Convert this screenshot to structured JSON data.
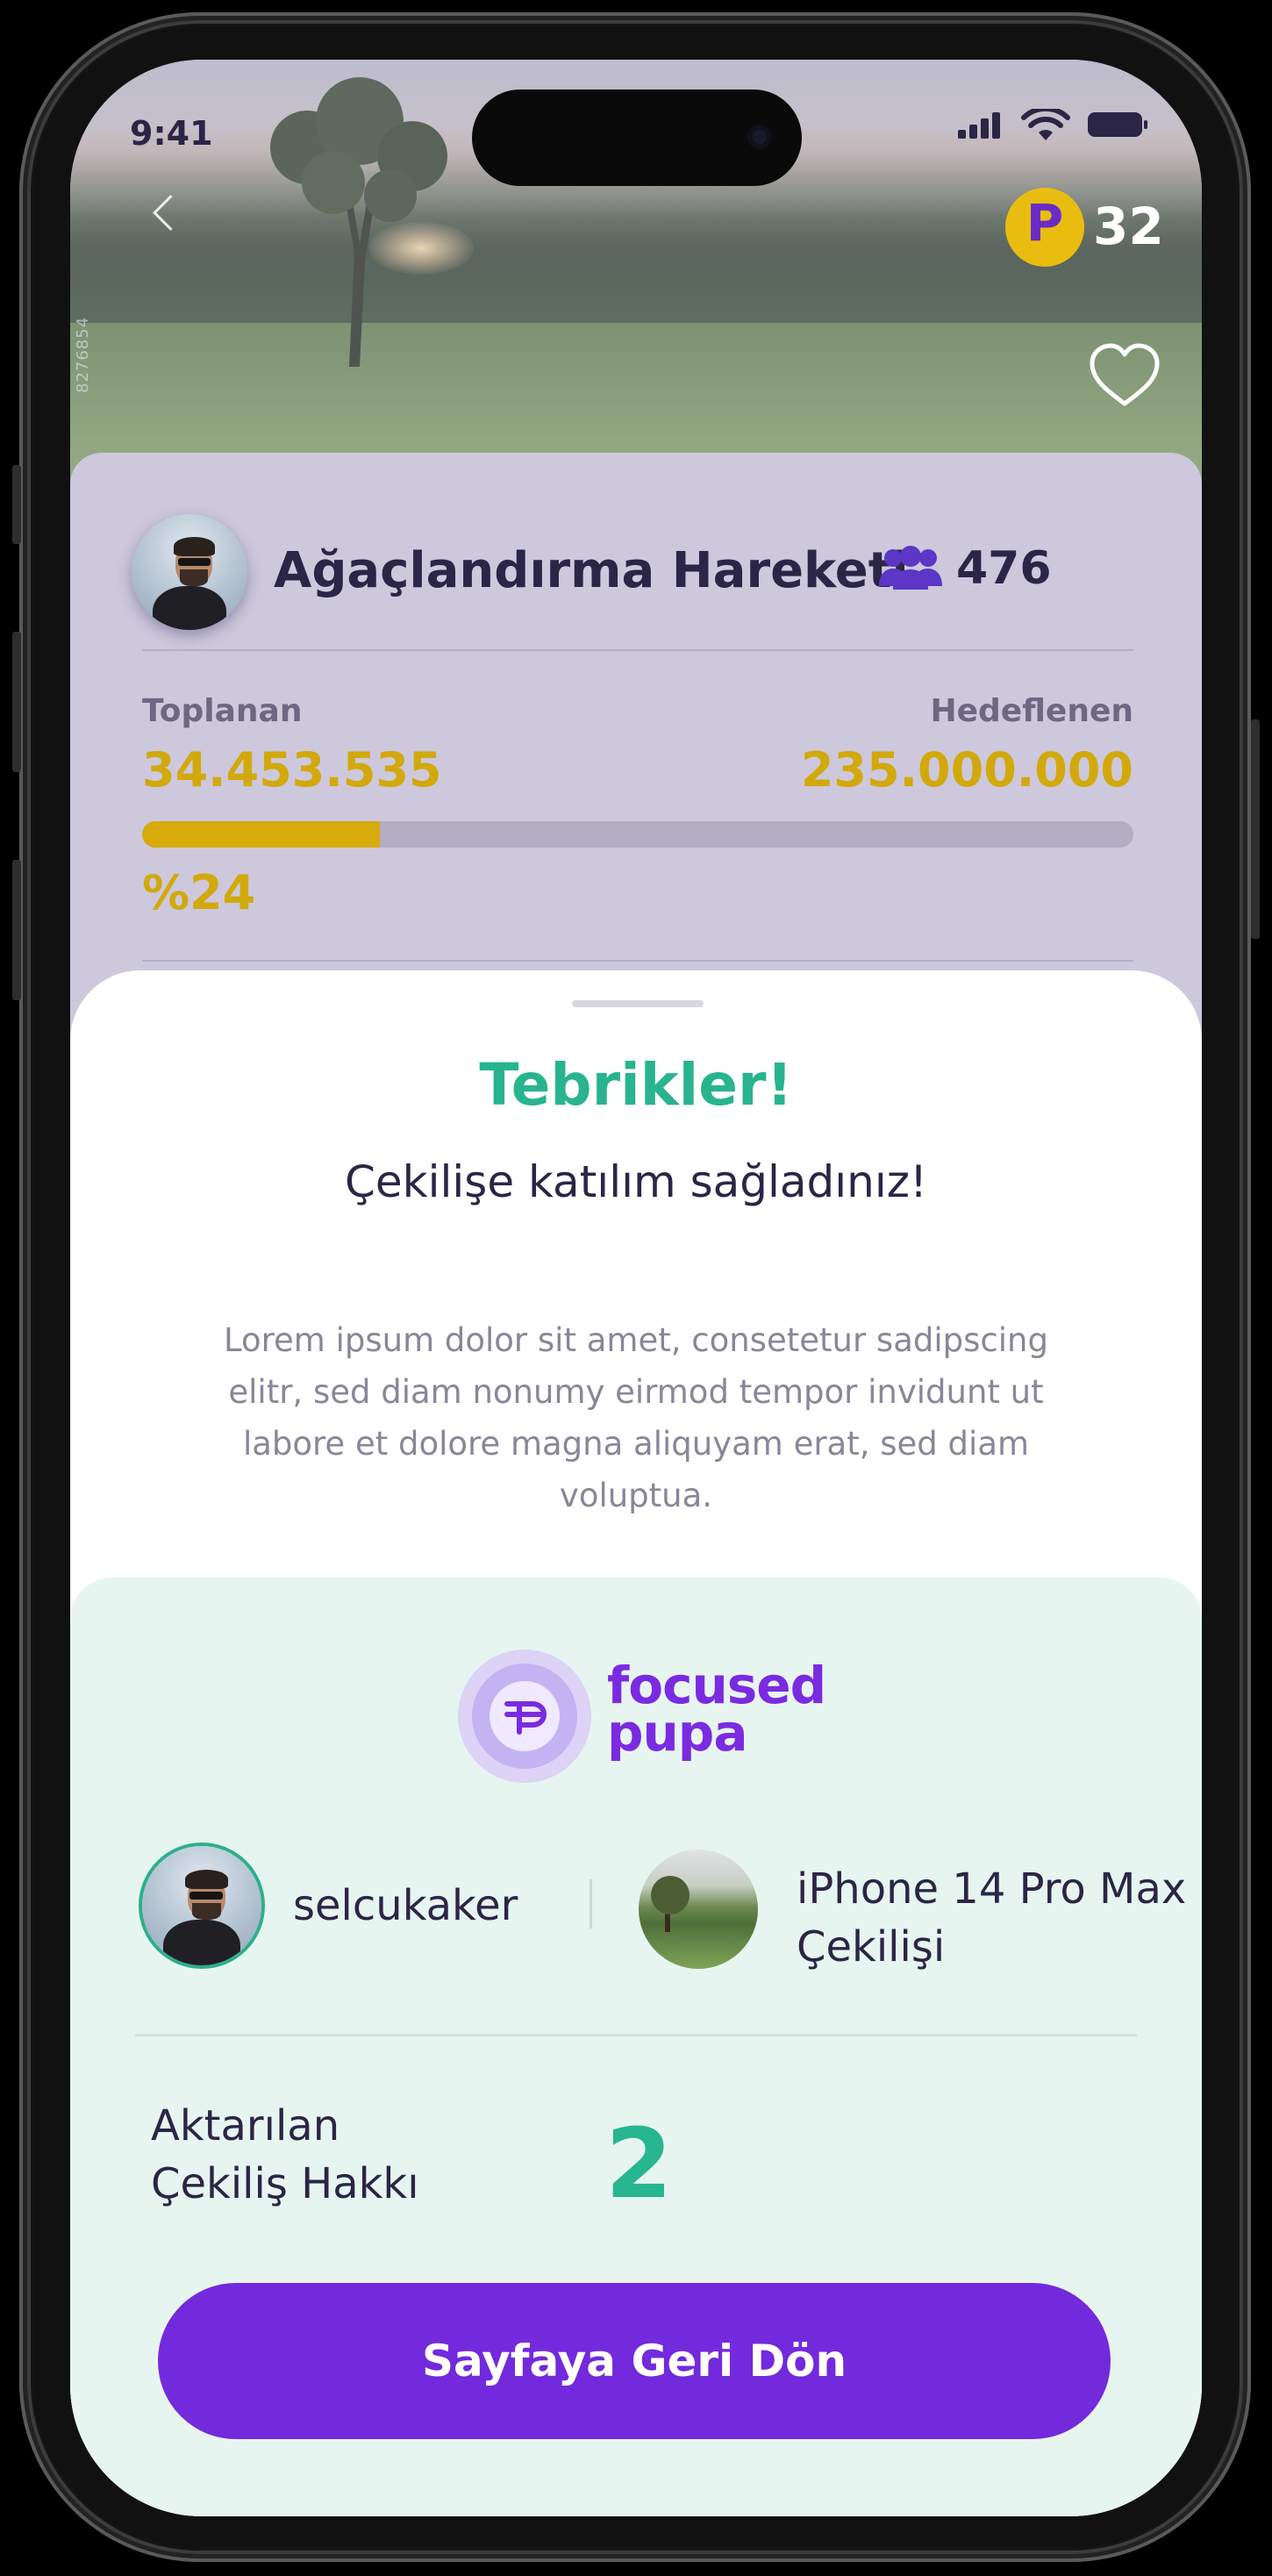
{
  "status_bar": {
    "time": "9:41"
  },
  "hero": {
    "watermark": "8276854",
    "coin_letter": "P",
    "coin_count": "32"
  },
  "campaign": {
    "title": "Ağaçlandırma Hareketi",
    "participants": "476",
    "collected_label": "Toplanan",
    "collected_value": "34.453.535",
    "target_label": "Hedeflenen",
    "target_value": "235.000.000",
    "progress_percent_text": "%24",
    "progress_fraction": 0.24
  },
  "sheet": {
    "title": "Tebrikler!",
    "subtitle": "Çekilişe katılım sağladınız!",
    "body": "Lorem ipsum dolor sit amet, consetetur sadipscing elitr, sed diam nonumy eirmod tempor invidunt ut labore et dolore magna aliquyam erat, sed diam voluptua."
  },
  "summary": {
    "brand_line1": "focused",
    "brand_line2": "pupa",
    "username": "selcukaker",
    "prize_line1": "iPhone 14 Pro Max",
    "prize_line2": "Çekilişi",
    "transfer_label_line1": "Aktarılan",
    "transfer_label_line2": "Çekiliş Hakkı",
    "transfer_value": "2"
  },
  "cta": {
    "label": "Sayfaya Geri Dön"
  },
  "colors": {
    "accent_purple": "#7329dc",
    "success_green": "#27b68f",
    "gold": "#d2a90c",
    "text_dark": "#2b2546",
    "panel_mint": "#e7f5f1"
  },
  "icons": [
    "back-chevron-icon",
    "p-coin-icon",
    "heart-icon",
    "people-icon",
    "focused-pupa-logo-icon"
  ]
}
